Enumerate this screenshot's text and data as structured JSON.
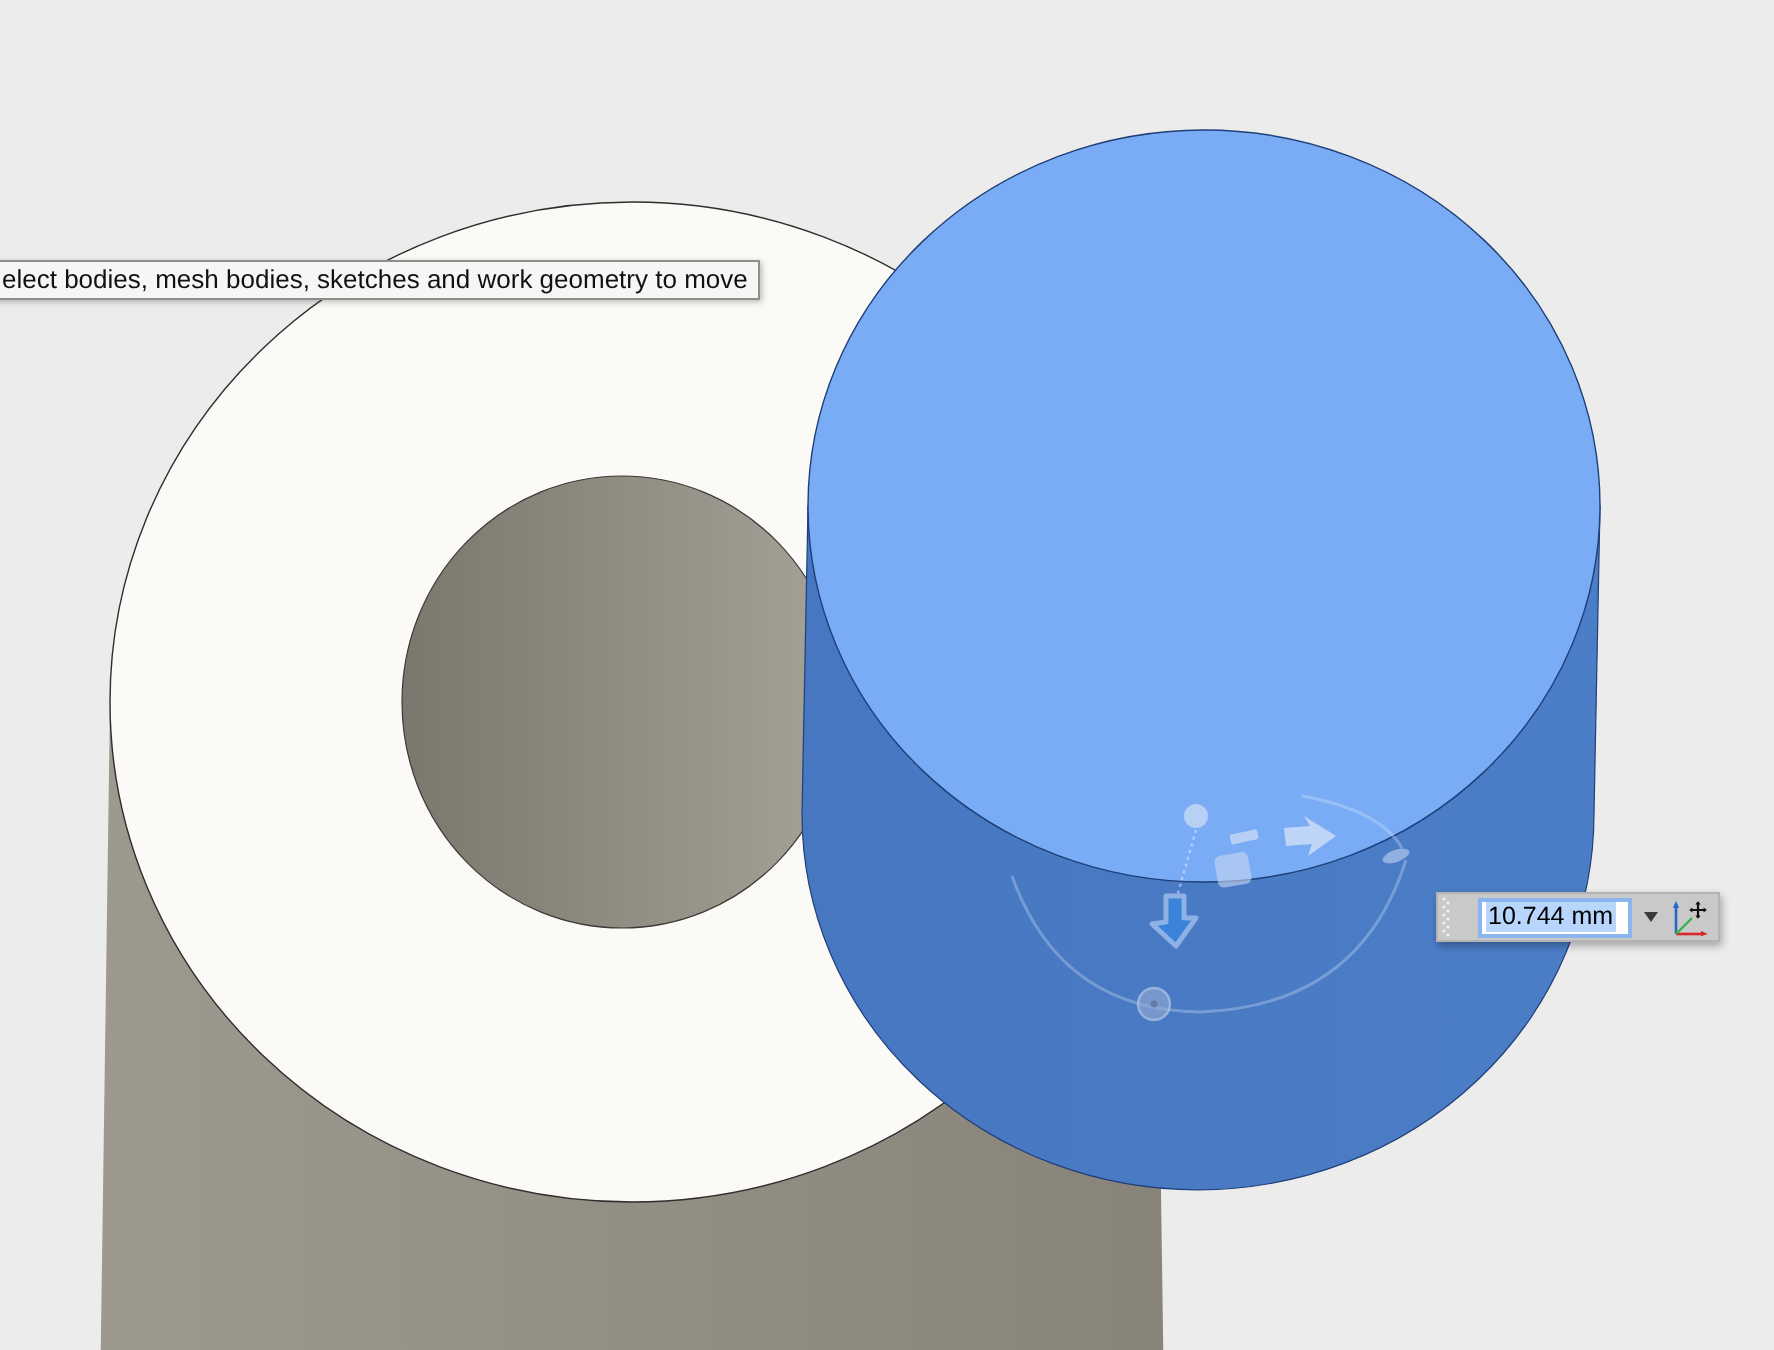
{
  "bodies": [
    {
      "kind": "tube",
      "selected": false
    },
    {
      "kind": "cylinder",
      "selected": true
    }
  ],
  "tooltip": {
    "text": "elect bodies, mesh bodies, sketches and work geometry to move"
  },
  "value_input": {
    "value": "10.744 mm",
    "focused": true,
    "text_selected": true
  }
}
